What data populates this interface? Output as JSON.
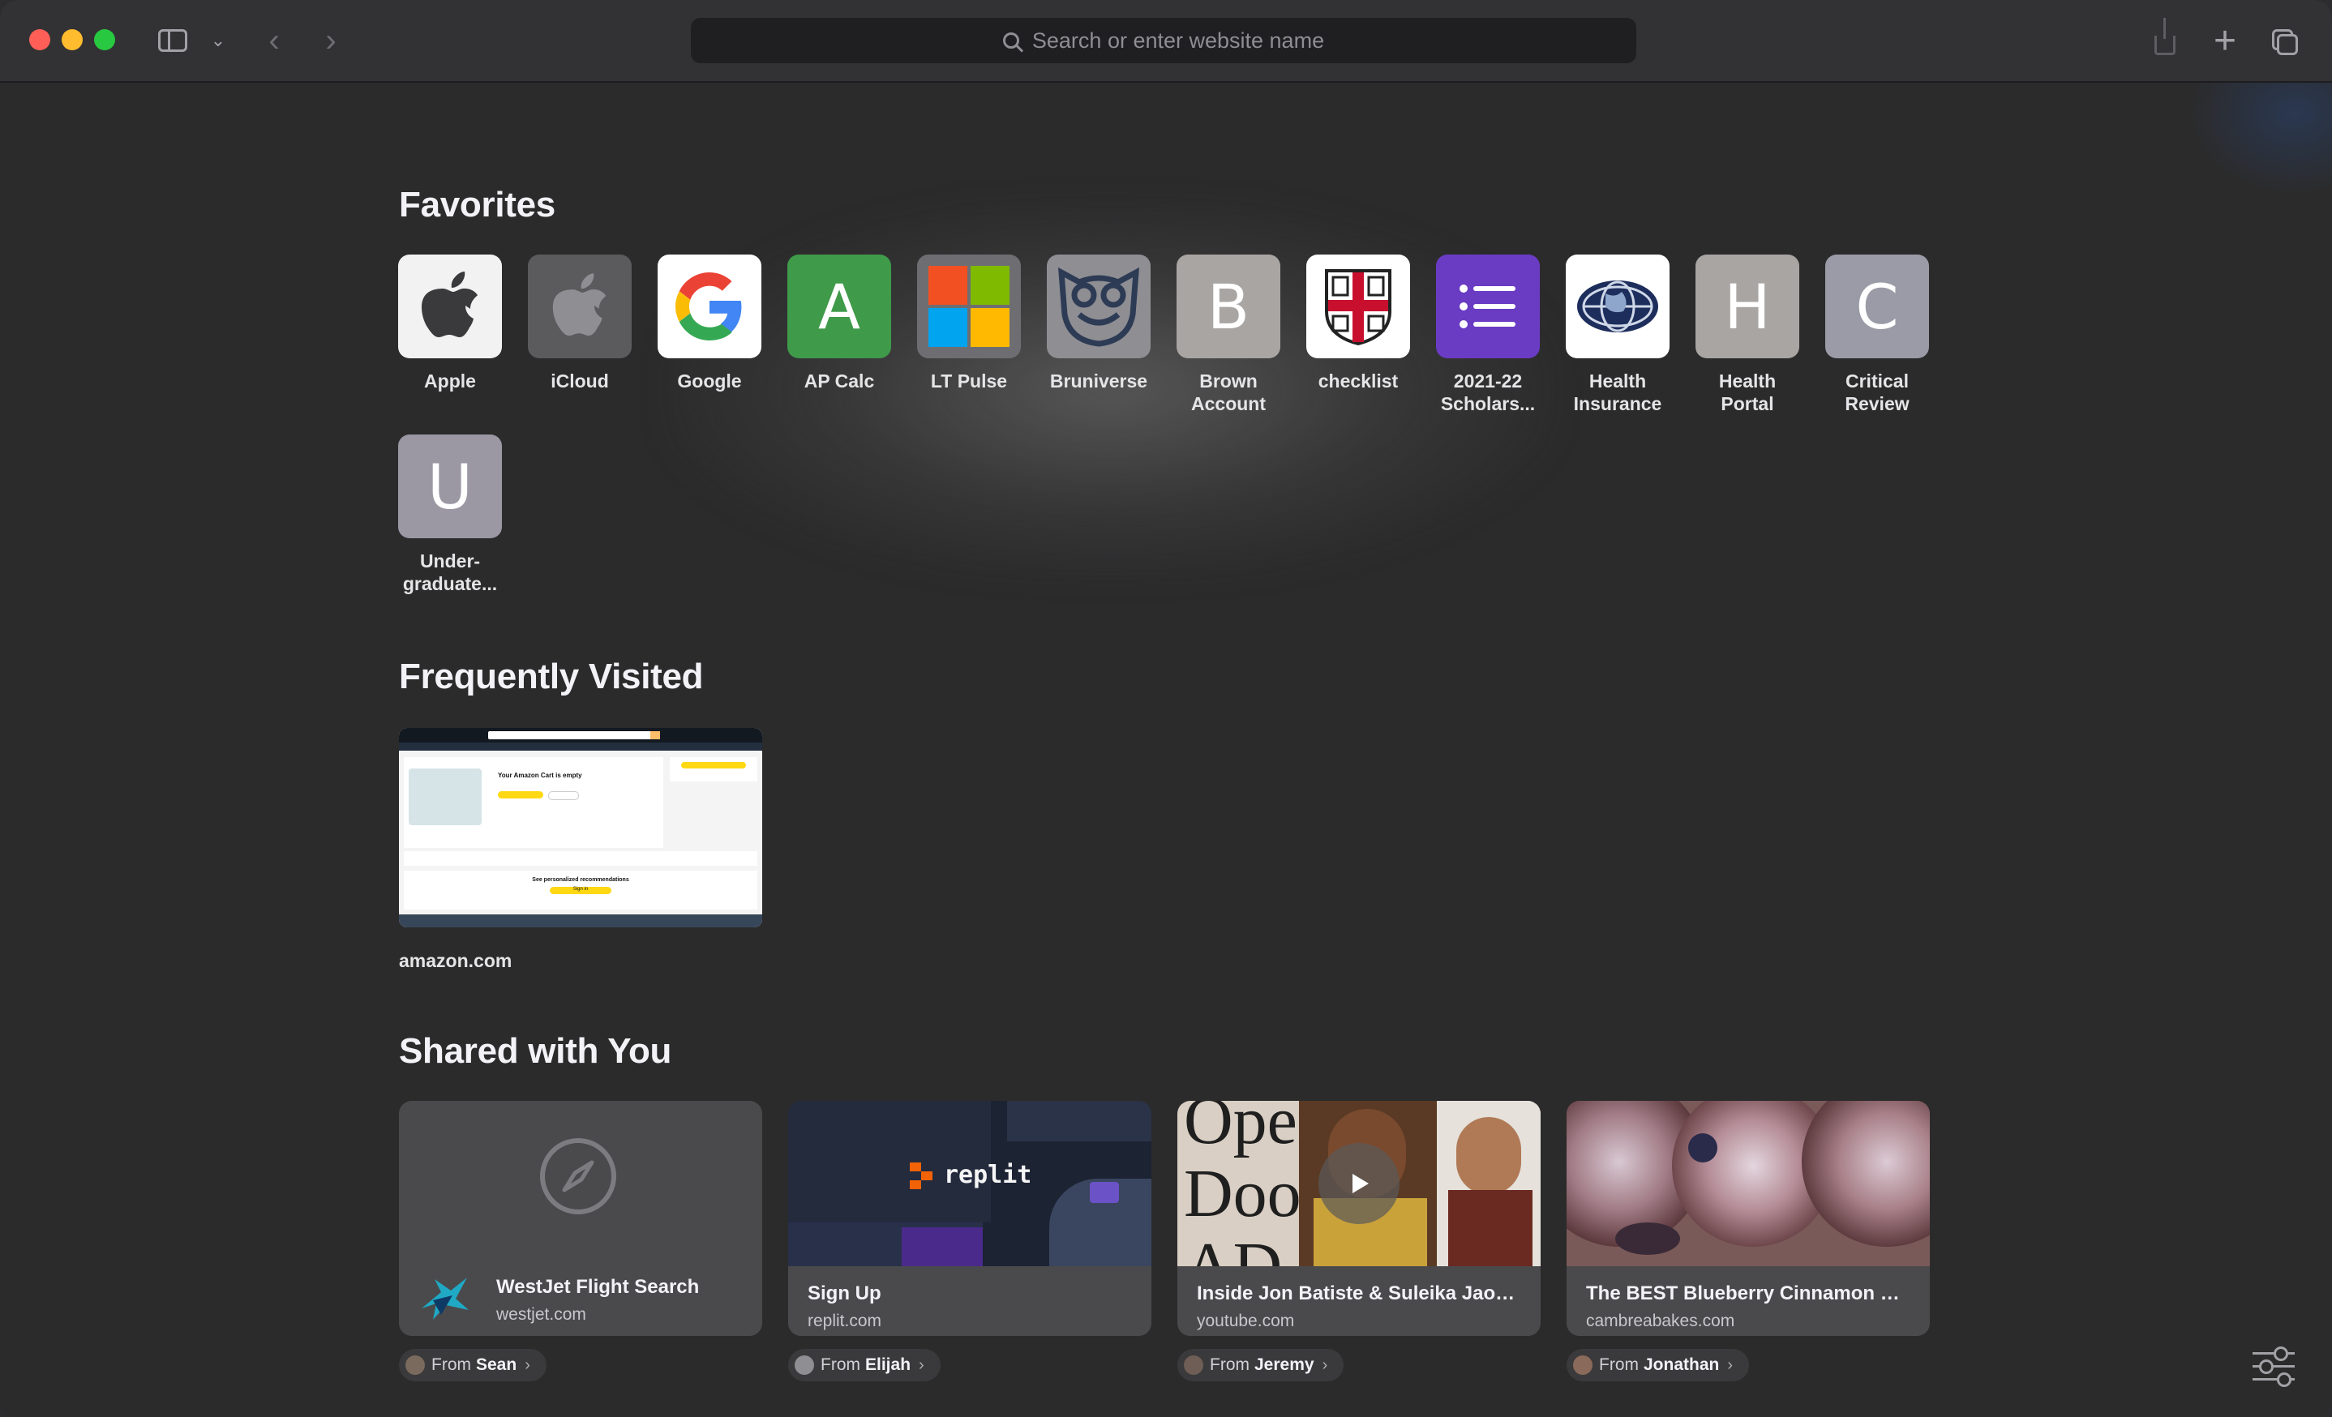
{
  "toolbar": {
    "search_placeholder": "Search or enter website name"
  },
  "sections": {
    "favorites": "Favorites",
    "frequently_visited": "Frequently Visited",
    "shared_with_you": "Shared with You"
  },
  "favorites": [
    {
      "label": "Apple",
      "icon": "apple-logo-icon"
    },
    {
      "label": "iCloud",
      "icon": "apple-logo-icon"
    },
    {
      "label": "Google",
      "icon": "google-logo-icon"
    },
    {
      "label": "AP Calc",
      "letter": "A",
      "color": "#3f9a4a"
    },
    {
      "label": "LT Pulse",
      "icon": "windows-logo-icon"
    },
    {
      "label": "Bruniverse",
      "icon": "owl-logo-icon"
    },
    {
      "label": "Brown\nAccount",
      "letter": "B",
      "color": "#a9a5a3"
    },
    {
      "label": "checklist",
      "icon": "crest-logo-icon"
    },
    {
      "label": "2021-22\nScholars...",
      "icon": "list-icon",
      "color": "#6a3cc4"
    },
    {
      "label": "Health\nInsurance",
      "icon": "globe-logo-icon"
    },
    {
      "label": "Health\nPortal",
      "letter": "H",
      "color": "#a9a5a3"
    },
    {
      "label": "Critical\nReview",
      "letter": "C",
      "color": "#9a9ba6"
    },
    {
      "label": "Under-\ngraduate...",
      "letter": "U",
      "color": "#9b98a4"
    }
  ],
  "frequently_visited": [
    {
      "label": "amazon.com",
      "preview": {
        "cart_title": "Your Amazon Cart is empty",
        "reco_text": "See personalized recommendations",
        "sign_in": "Sign in"
      }
    }
  ],
  "shared": [
    {
      "title": "WestJet Flight Search",
      "domain": "westjet.com",
      "from": "Sean"
    },
    {
      "title": "Sign Up",
      "domain": "replit.com",
      "from": "Elijah",
      "logo_text": "replit"
    },
    {
      "title": "Inside Jon Batiste & Suleika Jaouad...",
      "domain": "youtube.com",
      "from": "Jeremy",
      "overlay_text": "Open Door AD"
    },
    {
      "title": "The BEST Blueberry Cinnamon Rolls",
      "domain": "cambreabakes.com",
      "from": "Jonathan"
    }
  ],
  "from_prefix": "From"
}
